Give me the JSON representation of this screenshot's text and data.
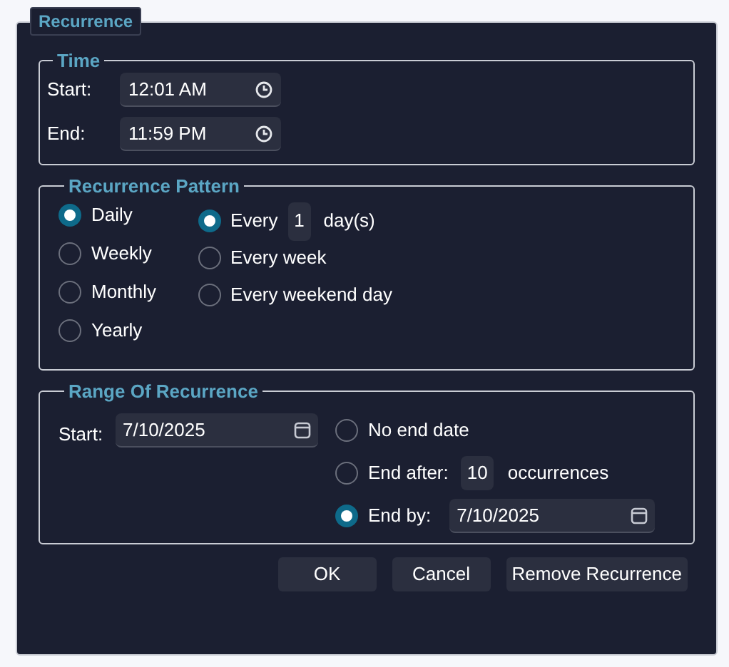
{
  "dialog": {
    "title": "Recurrence",
    "time": {
      "title": "Time",
      "fields": [
        {
          "label": "Start:",
          "value": "12:01 AM"
        },
        {
          "label": "End:",
          "value": "11:59 PM"
        }
      ]
    },
    "pattern": {
      "title": "Recurrence Pattern",
      "frequencies": [
        {
          "label": "Daily",
          "selected": true
        },
        {
          "label": "Weekly",
          "selected": false
        },
        {
          "label": "Monthly",
          "selected": false
        },
        {
          "label": "Yearly",
          "selected": false
        }
      ],
      "daily_options": [
        {
          "kind": "every_n",
          "label": "Every",
          "value": "1",
          "unit": "day(s)",
          "selected": true
        },
        {
          "kind": "plain",
          "label": "Every week",
          "selected": false
        },
        {
          "kind": "plain",
          "label": "Every weekend day",
          "selected": false
        }
      ]
    },
    "range": {
      "title": "Range Of Recurrence",
      "start": {
        "label": "Start:",
        "value": "7/10/2025"
      },
      "end_options": [
        {
          "kind": "plain",
          "label": "No end date",
          "selected": false
        },
        {
          "kind": "count",
          "label": "End after:",
          "value": "10",
          "unit": "occurrences",
          "selected": false
        },
        {
          "kind": "date",
          "label": "End by:",
          "value": "7/10/2025",
          "selected": true
        }
      ]
    },
    "buttons": [
      "OK",
      "Cancel",
      "Remove Recurrence"
    ]
  }
}
